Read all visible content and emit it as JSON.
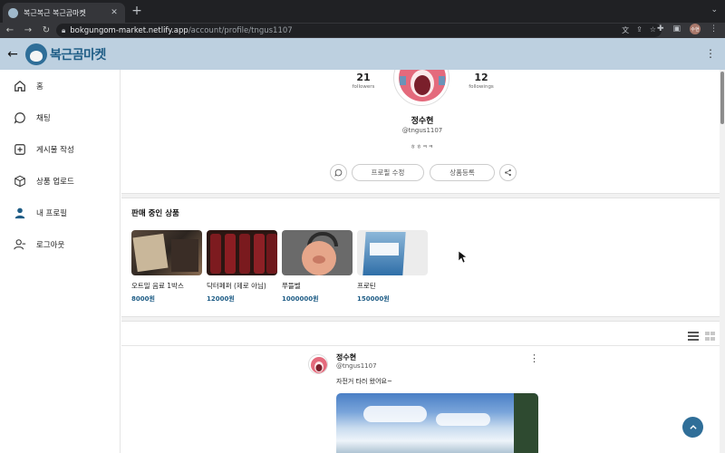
{
  "browser": {
    "tab_title": "복근복근 복근곰마켓",
    "url_host": "bokgungom-market.netlify.app",
    "url_path": "/account/profile/tngus1107",
    "profile_initials": "수현"
  },
  "header": {
    "logo_text": "복근곰마켓"
  },
  "sidebar": {
    "items": [
      {
        "label": "홈",
        "icon": "home-icon"
      },
      {
        "label": "채팅",
        "icon": "chat-icon"
      },
      {
        "label": "게시물 작성",
        "icon": "plus-square-icon"
      },
      {
        "label": "상품 업로드",
        "icon": "box-icon"
      },
      {
        "label": "내 프로필",
        "icon": "user-icon"
      },
      {
        "label": "로그아웃",
        "icon": "logout-icon"
      }
    ]
  },
  "profile": {
    "followers_count": "21",
    "followers_label": "followers",
    "followings_count": "12",
    "followings_label": "followings",
    "name": "정수현",
    "handle": "@tngus1107",
    "bio": "ㅎㅎㅋㅋ",
    "edit_button": "프로필 수정",
    "add_product_button": "상품등록"
  },
  "products": {
    "title": "판매 중인 상품",
    "items": [
      {
        "name": "오트밀 음료 1박스",
        "price": "8000원"
      },
      {
        "name": "닥터페퍼 (제로 아님)",
        "price": "12000원"
      },
      {
        "name": "쭈뜰벨",
        "price": "1000000원"
      },
      {
        "name": "프로틴",
        "price": "150000원"
      }
    ]
  },
  "post": {
    "author_name": "정수현",
    "author_handle": "@tngus1107",
    "text": "자전거 타러 왔어요~"
  },
  "colors": {
    "brand": "#1f5d86",
    "header_bg": "#bdd0e0",
    "price": "#1f5d86"
  }
}
